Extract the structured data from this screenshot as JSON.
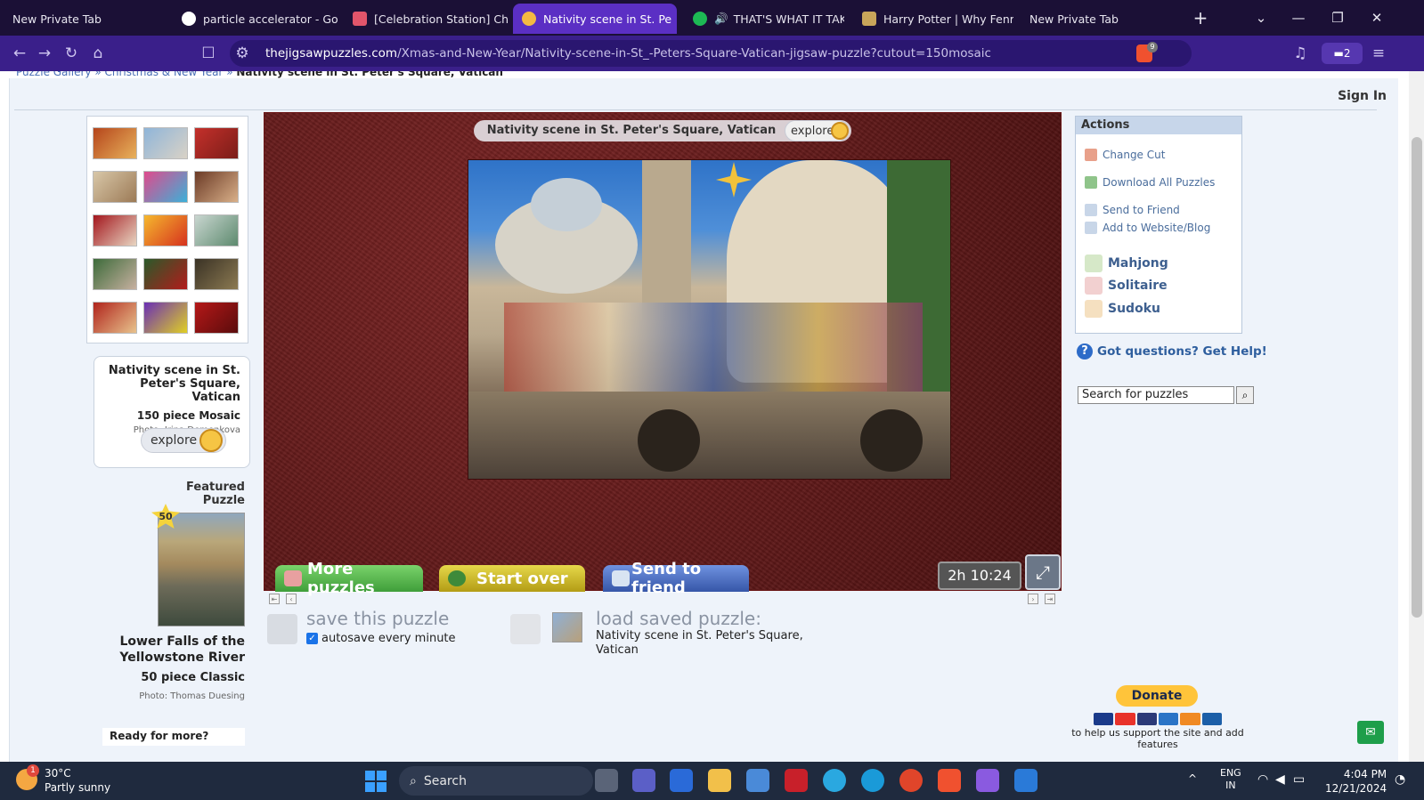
{
  "browser": {
    "tabs": [
      {
        "label": "New Private Tab",
        "active": false
      },
      {
        "label": "particle accelerator - Googl",
        "active": false
      },
      {
        "label": "[Celebration Station] Christ",
        "active": false
      },
      {
        "label": "Nativity scene in St. Pe",
        "active": true
      },
      {
        "label": "THAT'S WHAT IT TAKES",
        "active": false
      },
      {
        "label": "Harry Potter | Why Fenrir G",
        "active": false
      },
      {
        "label": "New Private Tab",
        "active": false
      }
    ],
    "new_tab": "+",
    "url_domain": "thejigsawpuzzles.com",
    "url_path": "/Xmas-and-New-Year/Nativity-scene-in-St_-Peters-Square-Vatican-jigsaw-puzzle?cutout=150mosaic",
    "shield_count": "9",
    "wallet_count": "2"
  },
  "page": {
    "breadcrumb": {
      "items": [
        "Puzzle Gallery",
        "Christmas & New Year"
      ],
      "current": "Nativity scene in St. Peter's Square, Vatican"
    },
    "sign_in": "Sign In",
    "puzzle_info": {
      "title": "Nativity scene in St. Peter's Square, Vatican",
      "pieces": "150 piece Mosaic",
      "photo": "Photo: Irina Demenkova",
      "explore": "explore"
    },
    "featured": {
      "label": "Featured Puzzle",
      "badge": "50",
      "title": "Lower Falls of the Yellowstone River",
      "pieces": "50 piece Classic",
      "photo": "Photo: Thomas Duesing"
    },
    "ready": "Ready for more?",
    "board": {
      "title": "Nativity scene in St. Peter's Square, Vatican",
      "explore": "explore",
      "more_puzzles": "More puzzles",
      "start_over": "Start over",
      "send_to_friend": "Send to friend",
      "timer": "2h 10:24"
    },
    "save": {
      "label": "save this puzzle",
      "autosave": "autosave every minute",
      "autosave_checked": true,
      "load_label": "load saved puzzle:",
      "load_name": "Nativity scene in St. Peter's Square, Vatican"
    },
    "actions": {
      "heading": "Actions",
      "items": [
        "Change Cut",
        "Download All Puzzles",
        "Send to Friend",
        "Add to Website/Blog"
      ],
      "games": [
        "Mahjong",
        "Solitaire",
        "Sudoku"
      ]
    },
    "help": "Got questions? Get Help!",
    "search_placeholder": "Search for puzzles",
    "donate": "Donate",
    "support": "to help us support the site and add features"
  },
  "taskbar": {
    "temp": "30°C",
    "condition": "Partly sunny",
    "weather_badge": "1",
    "search": "Search",
    "lang": "ENG",
    "region": "IN",
    "time": "4:04 PM",
    "date": "12/21/2024"
  },
  "colors": {
    "tab_active": "#5b2fc4",
    "board_red": "#5e1818",
    "more_puzzles_btn": "#5bc05a",
    "start_over_btn": "#d8c52c",
    "send_friend_btn": "#4f74c9"
  }
}
